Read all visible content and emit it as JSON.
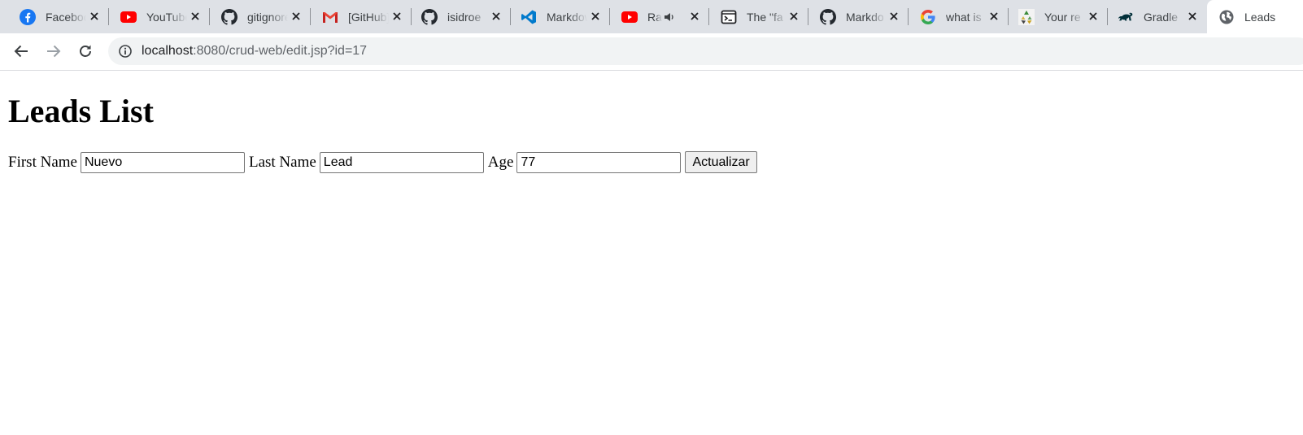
{
  "tabs": [
    {
      "title": "Facebook",
      "icon": "facebook-icon"
    },
    {
      "title": "YouTube",
      "icon": "youtube-icon"
    },
    {
      "title": "gitignore",
      "icon": "github-icon"
    },
    {
      "title": "[GitHub]",
      "icon": "gmail-icon"
    },
    {
      "title": "isidroe",
      "icon": "github-icon"
    },
    {
      "title": "Markdown",
      "icon": "vscode-icon"
    },
    {
      "title": "Ra",
      "icon": "youtube-icon",
      "playing_audio": true
    },
    {
      "title": "The \"fa",
      "icon": "terminal-icon"
    },
    {
      "title": "Markdo",
      "icon": "github-icon"
    },
    {
      "title": "what is",
      "icon": "google-icon"
    },
    {
      "title": "Your re",
      "icon": "recycle-icon"
    },
    {
      "title": "Gradle",
      "icon": "gradle-icon"
    },
    {
      "title": "Leads",
      "icon": "globe-icon",
      "active": true
    }
  ],
  "toolbar": {
    "url_host": "localhost",
    "url_rest": ":8080/crud-web/edit.jsp?id=17"
  },
  "page": {
    "heading": "Leads List",
    "form": {
      "first_name_label": "First Name",
      "first_name_value": "Nuevo",
      "last_name_label": "Last Name",
      "last_name_value": "Lead",
      "age_label": "Age",
      "age_value": "77",
      "submit_label": "Actualizar"
    }
  },
  "colors": {
    "tabstrip_bg": "#dee1e6",
    "omnibox_bg": "#f1f3f4",
    "youtube_red": "#ff0000",
    "facebook_blue": "#1877f2",
    "vscode_blue": "#007acc"
  }
}
